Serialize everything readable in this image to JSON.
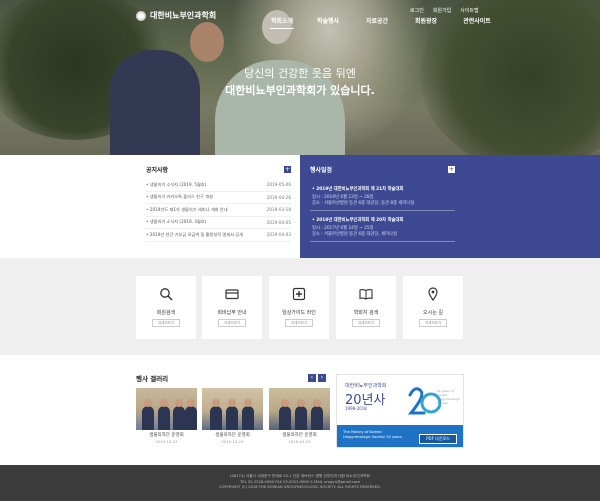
{
  "header": {
    "logo_text": "대한비뇨부인과학회",
    "utility": [
      "로그인",
      "회원가입",
      "사이트맵"
    ],
    "nav": [
      "학회소개",
      "학술행사",
      "자료공간",
      "회원광장",
      "관련사이트"
    ],
    "nav_active": 0
  },
  "hero": {
    "line1": "당신의 건강한 웃음 뒤엔",
    "line2": "대한비뇨부인과학회가 있습니다."
  },
  "notice": {
    "title": "공지사항",
    "more": "+",
    "items": [
      {
        "text": "• 생물의기 소식지 (2019. 5월호)",
        "date": "2019-05-06"
      },
      {
        "text": "• 생물의기 카카오톡 플러스 친구 개설",
        "date": "2019-04-26"
      },
      {
        "text": "• 2019년도 제1차 생물의기 세미나 개최 안내",
        "date": "2019-03-18"
      },
      {
        "text": "• 생물의기 소식지 (2019. 4월호)",
        "date": "2019-04-05"
      },
      {
        "text": "• 2019년 연간 기부금 모금액 및 활용실적 명세서 공개",
        "date": "2019-04-03"
      }
    ]
  },
  "events": {
    "title": "행사일정",
    "more": "+",
    "items": [
      {
        "title": "• 2019년 대한비뇨부인과학회 제 21차 학술대회",
        "meta1": "일시 : 2019년 6월 23일 ~ 28일",
        "meta2": "장소 : 서울아산병원 동관 6층 대강당, 동관 8층 세미나실"
      },
      {
        "title": "• 2018년 대한비뇨부인과학회 제 20차 학술대회",
        "meta1": "일시 : 2017년 6월 24일 ~ 25일",
        "meta2": "장소 : 서울아산병원 동관 6층 대강당, 세미나실"
      }
    ]
  },
  "quick": {
    "cards": [
      {
        "label": "회원검색",
        "btn": "자세히보기",
        "icon": "search-icon"
      },
      {
        "label": "회비납부 안내",
        "btn": "자세히보기",
        "icon": "card-icon"
      },
      {
        "label": "임상가이드 라인",
        "btn": "자세히보기",
        "icon": "medical-cross-icon"
      },
      {
        "label": "학회지 검색",
        "btn": "자세히보기",
        "icon": "book-icon"
      },
      {
        "label": "오시는 길",
        "btn": "자세히보기",
        "icon": "map-pin-icon"
      }
    ]
  },
  "gallery": {
    "title": "행사 갤러리",
    "prev": "‹",
    "next": "›",
    "items": [
      {
        "caption": "생물의자단 운영회",
        "date": "2019-10-23"
      },
      {
        "caption": "생물의자단 운영회",
        "date": "2019-10-25"
      },
      {
        "caption": "생물의자단 운영회",
        "date": "2019-10-29"
      }
    ],
    "banner": {
      "subtitle": "대한비뇨부인과학회",
      "title": "20년사",
      "years": "1998-2018",
      "side_text": "20 years of Korean Urogynecologic Society",
      "eng": "The History of Korean Urogynecologic Society 20 years",
      "pdf_btn": "PDF 다운로드",
      "accent": "#1e73c6"
    }
  },
  "footer": {
    "line1": "(06174) 서울시 서대문구 연세로 50-1 신촌 세브란스 병원 산부인과 대한 비뇨부인과학회",
    "line2": "TEL 02-2228-0560  FAX 02-6323-9600  E-MAIL urogyn@gmail.com",
    "line3": "COPYRIGHT (C) 2018 THE KOREAN UROGYNECOLOGIC SOCIETY. ALL RIGHTS RESERVED."
  },
  "colors": {
    "brand": "#3d4a93",
    "footer_bg": "#3b3b3b"
  }
}
